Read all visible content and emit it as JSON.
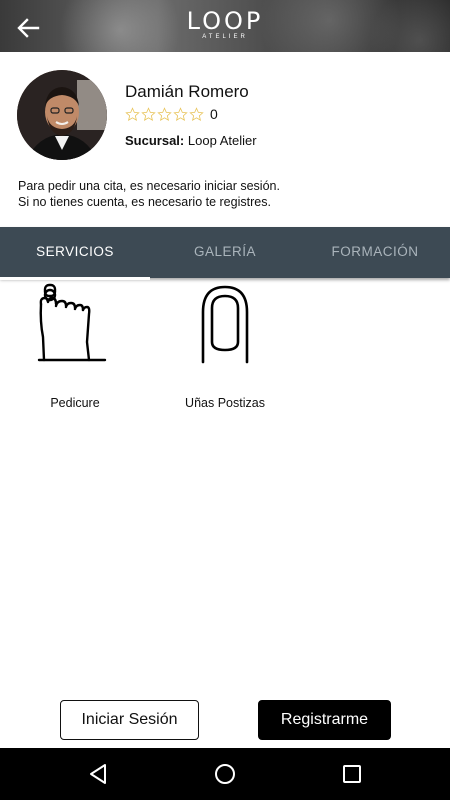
{
  "header": {
    "logo_text": "LOOP",
    "logo_sub": "ATELIER"
  },
  "profile": {
    "name": "Damián Romero",
    "rating_count": "0",
    "branch_label": "Sucursal:",
    "branch_value": "Loop Atelier",
    "stars_filled": 0,
    "stars_total": 5,
    "star_color": "#e8c45a"
  },
  "notice": {
    "line1": "Para pedir una cita, es necesario iniciar sesión.",
    "line2": "Si no tienes cuenta, es necesario te registres."
  },
  "tabs": [
    {
      "label": "SERVICIOS",
      "active": true
    },
    {
      "label": "GALERÍA",
      "active": false
    },
    {
      "label": "FORMACIÓN",
      "active": false
    }
  ],
  "services": [
    {
      "label": "Pedicure",
      "icon": "foot-icon"
    },
    {
      "label": "Uñas Postizas",
      "icon": "nail-icon"
    }
  ],
  "actions": {
    "login_label": "Iniciar Sesión",
    "register_label": "Registrarme"
  },
  "colors": {
    "tab_bar": "#3d4a54",
    "tab_active_text": "#ffffff",
    "tab_inactive_text": "#aab4bb",
    "register_bg": "#000000"
  },
  "navbar": {
    "icons": [
      "back-triangle-icon",
      "home-circle-icon",
      "recents-square-icon"
    ]
  }
}
